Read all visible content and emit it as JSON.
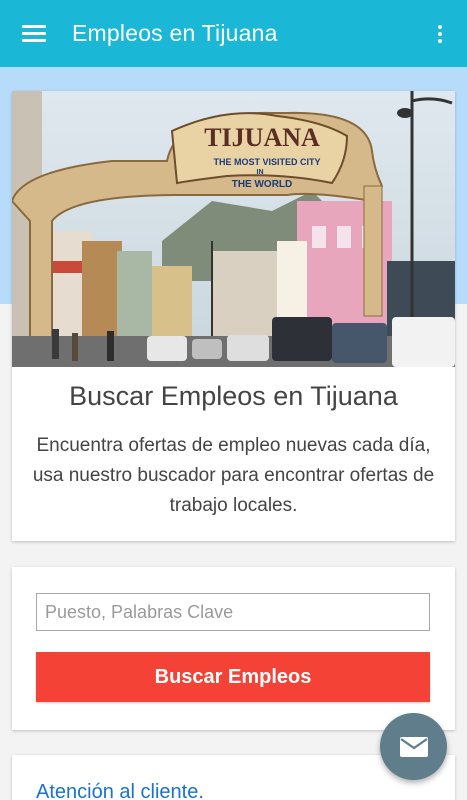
{
  "app_bar": {
    "title": "Empleos en Tijuana",
    "background": "#1ab7d6"
  },
  "hero": {
    "image_alt": "Tijuana arch",
    "arch_text_line1": "TIJUANA",
    "arch_text_line2": "THE MOST VISITED CITY",
    "arch_text_line3": "IN",
    "arch_text_line4": "THE WORLD",
    "title": "Buscar Empleos en Tijuana",
    "description": "Encuentra ofertas de empleo nuevas cada día, usa nuestro buscador para encontrar ofertas de trabajo locales."
  },
  "search": {
    "input_placeholder": "Puesto, Palabras Clave",
    "input_value": "",
    "button_label": "Buscar Empleos",
    "button_color": "#f44336"
  },
  "footer_card": {
    "link_label": "Atención al cliente."
  },
  "fab": {
    "icon": "mail-icon",
    "color": "#607d8b"
  }
}
